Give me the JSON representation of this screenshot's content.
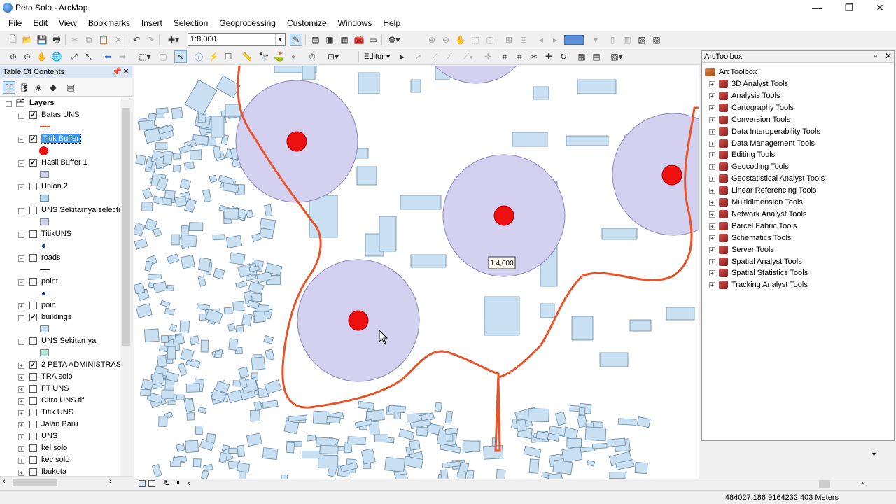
{
  "window": {
    "title": "Peta Solo - ArcMap",
    "min": "—",
    "max": "❐",
    "close": "✕"
  },
  "menu": [
    "File",
    "Edit",
    "View",
    "Bookmarks",
    "Insert",
    "Selection",
    "Geoprocessing",
    "Customize",
    "Windows",
    "Help"
  ],
  "toolbar": {
    "scale_value": "1:8,000",
    "editor_label": "Editor ▾"
  },
  "toc": {
    "title": "Table Of Contents",
    "root": "Layers",
    "layers": [
      {
        "name": "Batas UNS",
        "checked": true,
        "expanded": true
      },
      {
        "name": "Titik Buffer",
        "checked": true,
        "expanded": true,
        "selected": true
      },
      {
        "name": "Hasil Buffer 1",
        "checked": true,
        "expanded": true
      },
      {
        "name": "Union 2",
        "checked": false,
        "expanded": true
      },
      {
        "name": "UNS Sekitarnya selecti",
        "checked": false,
        "expanded": true
      },
      {
        "name": "TitikUNS",
        "checked": false,
        "expanded": true
      },
      {
        "name": "roads",
        "checked": false,
        "expanded": true
      },
      {
        "name": "point",
        "checked": false,
        "expanded": true
      },
      {
        "name": "poin",
        "checked": false,
        "expanded": false
      },
      {
        "name": "buildings",
        "checked": true,
        "expanded": true
      },
      {
        "name": "UNS Sekitarnya",
        "checked": false,
        "expanded": true
      },
      {
        "name": "2 PETA ADMINISTRASI",
        "checked": true,
        "expanded": false
      },
      {
        "name": "TRA solo",
        "checked": false,
        "expanded": false
      },
      {
        "name": "FT UNS",
        "checked": false,
        "expanded": false
      },
      {
        "name": "Citra UNS.tif",
        "checked": false,
        "expanded": false
      },
      {
        "name": "Titik UNS",
        "checked": false,
        "expanded": false
      },
      {
        "name": "Jalan Baru",
        "checked": false,
        "expanded": false
      },
      {
        "name": "UNS",
        "checked": false,
        "expanded": false
      },
      {
        "name": "kel solo",
        "checked": false,
        "expanded": false
      },
      {
        "name": "kec solo",
        "checked": false,
        "expanded": false
      },
      {
        "name": "Ibukota",
        "checked": false,
        "expanded": false
      }
    ]
  },
  "map": {
    "scale_tip": "1:4,000"
  },
  "toolbox": {
    "title": "ArcToolbox",
    "root": "ArcToolbox",
    "tools": [
      "3D Analyst Tools",
      "Analysis Tools",
      "Cartography Tools",
      "Conversion Tools",
      "Data Interoperability Tools",
      "Data Management Tools",
      "Editing Tools",
      "Geocoding Tools",
      "Geostatistical Analyst Tools",
      "Linear Referencing Tools",
      "Multidimension Tools",
      "Network Analyst Tools",
      "Parcel Fabric Tools",
      "Schematics Tools",
      "Server Tools",
      "Spatial Analyst Tools",
      "Spatial Statistics Tools",
      "Tracking Analyst Tools"
    ]
  },
  "status": {
    "coords": "484027.186  9164232.403 Meters"
  },
  "colors": {
    "buffer_fill": "#d4d0f0",
    "point": "#ee1111",
    "boundary": "#e8532a",
    "building": "#c9e0f2",
    "selection": "#3399ff"
  }
}
